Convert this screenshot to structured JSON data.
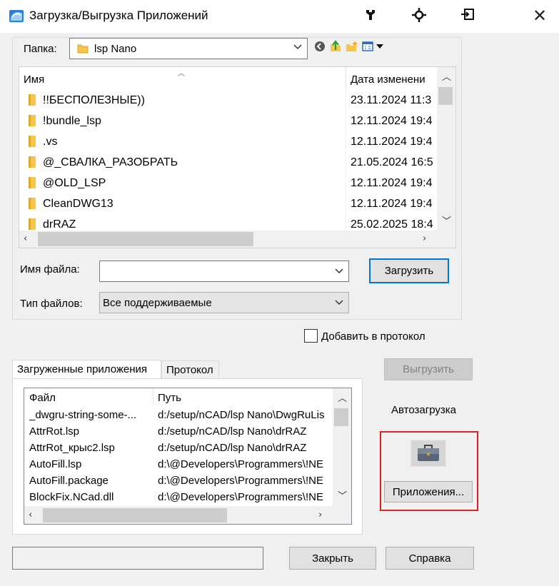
{
  "window": {
    "title": "Загрузка/Выгрузка Приложений",
    "close_glyph": "✕",
    "title_buttons": [
      "wrench-icon",
      "crosshair-icon",
      "export-icon"
    ]
  },
  "folder": {
    "label": "Папка:",
    "value": "lsp Nano"
  },
  "file_list": {
    "columns": [
      "Имя",
      "Дата изменени"
    ],
    "rows": [
      {
        "name": "!!БЕСПОЛЕЗНЫЕ))",
        "date": "23.11.2024 11:3"
      },
      {
        "name": "!bundle_lsp",
        "date": "12.11.2024 19:4"
      },
      {
        "name": ".vs",
        "date": "12.11.2024 19:4"
      },
      {
        "name": "@_СВАЛКА_РАЗОБРАТЬ",
        "date": "21.05.2024 16:5"
      },
      {
        "name": "@OLD_LSP",
        "date": "12.11.2024 19:4"
      },
      {
        "name": "CleanDWG13",
        "date": "12.11.2024 19:4"
      },
      {
        "name": "drRAZ",
        "date": "25.02.2025 18:4"
      }
    ]
  },
  "filename": {
    "label": "Имя файла:",
    "value": ""
  },
  "filetype": {
    "label": "Тип файлов:",
    "value": "Все поддерживаемые"
  },
  "buttons": {
    "load": "Загрузить",
    "unload": "Выгрузить",
    "close": "Закрыть",
    "help": "Справка",
    "apps": "Приложения..."
  },
  "add_to_history": {
    "label": "Добавить в протокол",
    "checked": false
  },
  "tabs": [
    "Загруженные приложения",
    "Протокол"
  ],
  "loaded_apps": {
    "columns": [
      "Файл",
      "Путь"
    ],
    "rows": [
      {
        "file": "_dwgru-string-some-...",
        "path": "d:/setup/nCAD/lsp Nano\\DwgRuLis"
      },
      {
        "file": "AttrRot.lsp",
        "path": "d:/setup/nCAD/lsp Nano\\drRAZ"
      },
      {
        "file": "AttrRot_крыс2.lsp",
        "path": "d:/setup/nCAD/lsp Nano\\drRAZ"
      },
      {
        "file": "AutoFill.lsp",
        "path": "d:\\@Developers\\Programmers\\!NE"
      },
      {
        "file": "AutoFill.package",
        "path": "d:\\@Developers\\Programmers\\!NE"
      },
      {
        "file": "BlockFix.NCad.dll",
        "path": "d:\\@Developers\\Programmers\\!NE"
      }
    ]
  },
  "autoload": {
    "label": "Автозагрузка"
  },
  "status": ""
}
